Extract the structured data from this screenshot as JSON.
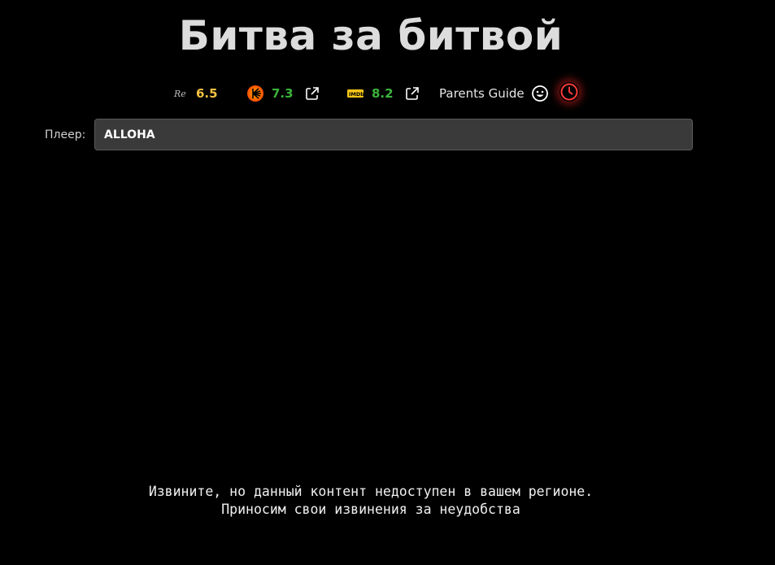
{
  "page": {
    "title": "Битва за битвой"
  },
  "ratings": {
    "rezka": {
      "icon": "rezka-logo-icon",
      "value": "6.5",
      "color": "#f5c242"
    },
    "kinopoisk": {
      "icon": "kinopoisk-logo-icon",
      "value": "7.3",
      "color": "#3bb33b",
      "external_icon": "external-link-icon"
    },
    "imdb": {
      "icon": "imdb-logo-icon",
      "value": "8.2",
      "color": "#3bb33b",
      "external_icon": "external-link-icon"
    },
    "parents_guide": {
      "label": "Parents Guide",
      "icon": "smile-icon"
    },
    "watch_later": {
      "icon": "clock-icon",
      "color": "#ff3b3b"
    }
  },
  "player": {
    "label": "Плеер:",
    "selected": "ALLOHA"
  },
  "message": {
    "line1": "Извините, но данный контент недоступен в вашем регионе.",
    "line2": "Приносим свои извинения за неудобства"
  }
}
